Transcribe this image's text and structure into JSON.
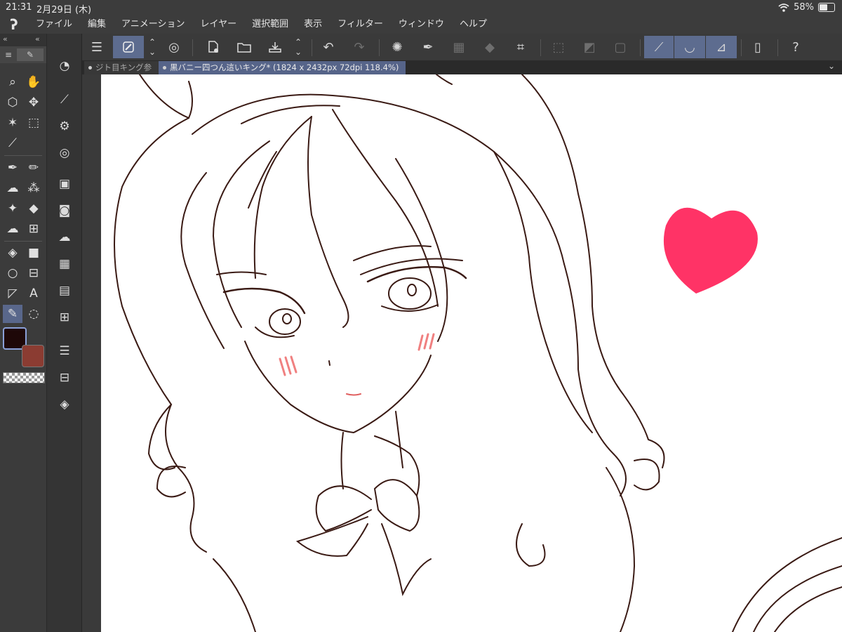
{
  "status": {
    "time": "21:31",
    "date": "2月29日 (木)",
    "battery": "58%"
  },
  "menu": {
    "logo": "ʔ",
    "items": [
      "ファイル",
      "編集",
      "アニメーション",
      "レイヤー",
      "選択範囲",
      "表示",
      "フィルター",
      "ウィンドウ",
      "ヘルプ"
    ]
  },
  "tabs": [
    {
      "label": "ジト目キング参"
    },
    {
      "label": "黒バニー四つん這いキング* (1824 x 2432px 72dpi 118.4%)"
    }
  ],
  "colors": {
    "main": "#1e0808",
    "sub": "#8b3c32",
    "accent": "#5d6c8f",
    "line": "#3a1a14",
    "heart": "#ff3366",
    "blush": "#f08080"
  },
  "icons": {
    "command_bar": [
      "menu-icon",
      "pen-settings-icon",
      "up-down-icon",
      "spiral-icon",
      "new-canvas-icon",
      "open-folder-icon",
      "save-icon",
      "up-down-icon",
      "undo-icon",
      "redo-icon",
      "loading-icon",
      "pen-icon",
      "select-dim-icon",
      "fill-icon",
      "transform-icon",
      "deselect-icon",
      "invert-icon",
      "border-icon",
      "stroke-icon",
      "brush-stroke-icon",
      "ruler-icon",
      "device-icon",
      "help-icon"
    ],
    "tools": [
      "zoom-icon",
      "hand-icon",
      "cube-icon",
      "move-icon",
      "magic-wand-icon",
      "select-rect-icon",
      "eyedropper-icon",
      "pen-icon",
      "pencil-icon",
      "brush-icon",
      "airbrush-icon",
      "sparkle-icon",
      "eraser-icon",
      "blend-icon",
      "grid-icon",
      "fill-icon",
      "gradient-icon",
      "circle-icon",
      "frame-icon",
      "ruler-icon",
      "text-icon",
      "line-pen-icon",
      "speech-balloon-icon"
    ]
  }
}
